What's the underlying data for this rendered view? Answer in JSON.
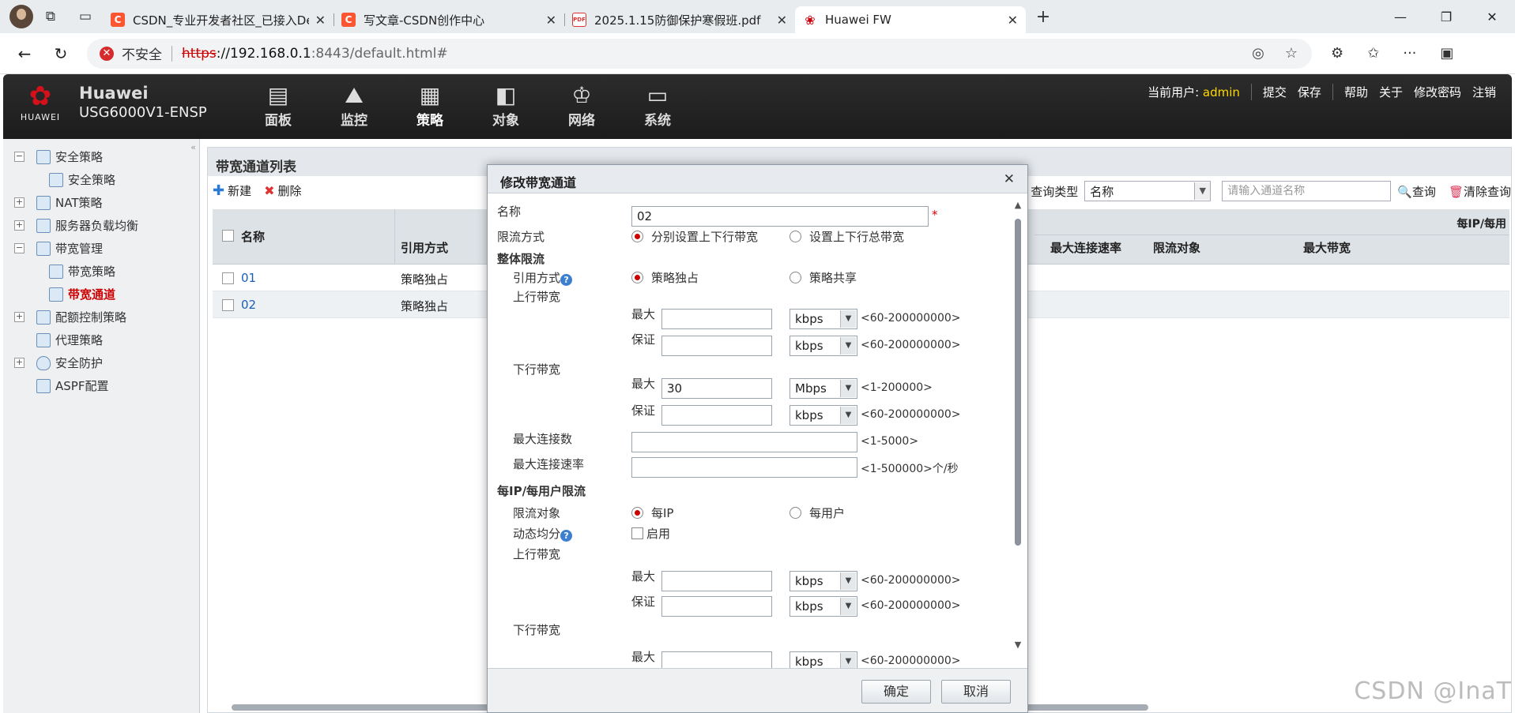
{
  "browser": {
    "tabs": [
      {
        "title": "CSDN_专业开发者社区_已接入De",
        "icon": "csdn-icon"
      },
      {
        "title": "写文章-CSDN创作中心",
        "icon": "csdn-icon"
      },
      {
        "title": "2025.1.15防御保护寒假班.pdf",
        "icon": "pdf-icon"
      },
      {
        "title": "Huawei FW",
        "icon": "huawei-icon",
        "active": true
      }
    ],
    "insecure_label": "不安全",
    "url_scheme": "https",
    "url_host": "://192.168.0.1",
    "url_path": ":8443/default.html#"
  },
  "app": {
    "brand_line1": "Huawei",
    "brand_line2": "USG6000V1-ENSP",
    "logo_text": "HUAWEI",
    "nav": [
      "面板",
      "监控",
      "策略",
      "对象",
      "网络",
      "系统"
    ],
    "active_nav": "策略",
    "current_user_label": "当前用户:",
    "username": "admin",
    "actions": [
      "提交",
      "保存",
      "帮助",
      "关于",
      "修改密码",
      "注销"
    ]
  },
  "sidebar": {
    "items": [
      {
        "label": "安全策略",
        "level": 0,
        "expander": "−"
      },
      {
        "label": "安全策略",
        "level": 1
      },
      {
        "label": "NAT策略",
        "level": 0,
        "expander": "+"
      },
      {
        "label": "服务器负载均衡",
        "level": 0,
        "expander": "+"
      },
      {
        "label": "带宽管理",
        "level": 0,
        "expander": "−"
      },
      {
        "label": "带宽策略",
        "level": 1
      },
      {
        "label": "带宽通道",
        "level": 1,
        "selected": true
      },
      {
        "label": "配额控制策略",
        "level": 0,
        "expander": "+"
      },
      {
        "label": "代理策略",
        "level": 0
      },
      {
        "label": "安全防护",
        "level": 0,
        "expander": "+"
      },
      {
        "label": "ASPF配置",
        "level": 0
      }
    ]
  },
  "main": {
    "title": "带宽通道列表",
    "new_label": "新建",
    "delete_label": "删除",
    "query_type_label": "查询类型",
    "query_type_value": "名称",
    "search_placeholder": "请输入通道名称",
    "query_label": "查询",
    "clear_label": "清除查询",
    "columns": {
      "name": "名称",
      "ref_mode": "引用方式",
      "max_conn_rate": "最大连接速率",
      "limit_target": "限流对象",
      "max_bandwidth": "最大带宽",
      "group": "每IP/每用"
    },
    "rows": [
      {
        "name": "01",
        "ref_mode": "策略独占"
      },
      {
        "name": "02",
        "ref_mode": "策略独占"
      }
    ]
  },
  "dialog": {
    "title": "修改带宽通道",
    "name_label": "名称",
    "name_value": "02",
    "required_mark": "*",
    "limit_mode_label": "限流方式",
    "limit_mode_opt1": "分别设置上下行带宽",
    "limit_mode_opt2": "设置上下行总带宽",
    "overall_section": "整体限流",
    "ref_mode_label": "引用方式",
    "ref_mode_opt1": "策略独占",
    "ref_mode_opt2": "策略共享",
    "up_bw_label": "上行带宽",
    "down_bw_label": "下行带宽",
    "max_label": "最大",
    "guarantee_label": "保证",
    "up_max": {
      "value": "",
      "unit": "kbps",
      "range": "<60-200000000>"
    },
    "up_guarantee": {
      "value": "",
      "unit": "kbps",
      "range": "<60-200000000>"
    },
    "down_max": {
      "value": "30",
      "unit": "Mbps",
      "range": "<1-200000>"
    },
    "down_guarantee": {
      "value": "",
      "unit": "kbps",
      "range": "<60-200000000>"
    },
    "max_conn_label": "最大连接数",
    "max_conn_range": "<1-5000>",
    "max_conn_rate_label": "最大连接速率",
    "max_conn_rate_range": "<1-500000>个/秒",
    "per_section": "每IP/每用户限流",
    "target_label": "限流对象",
    "target_opt1": "每IP",
    "target_opt2": "每用户",
    "dynamic_label": "动态均分",
    "enable_label": "启用",
    "per_up_max": {
      "value": "",
      "unit": "kbps",
      "range": "<60-200000000>"
    },
    "per_up_guarantee": {
      "value": "",
      "unit": "kbps",
      "range": "<60-200000000>"
    },
    "per_down_max": {
      "value": "",
      "unit": "kbps",
      "range": "<60-200000000>"
    },
    "ok_label": "确定",
    "cancel_label": "取消"
  },
  "watermark": "CSDN @InaT"
}
